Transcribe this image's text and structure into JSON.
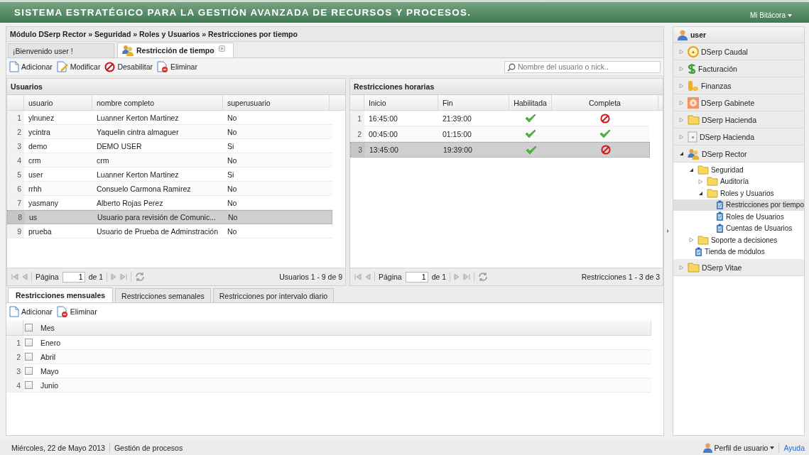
{
  "header": {
    "title": "SISTEMA ESTRATÉGICO PARA LA GESTIÓN AVANZADA DE RECURSOS Y PROCESOS.",
    "menu": "Mi Bitácora"
  },
  "breadcrumb": "Módulo DSerp Rector » Seguridad » Roles y Usuarios » Restricciones por tiempo",
  "tabs": [
    {
      "label": "¡Bienvenido user !",
      "selected": false,
      "closable": false
    },
    {
      "label": "Restricción de tiempo",
      "selected": true,
      "closable": true
    }
  ],
  "toolbar": {
    "buttons": [
      {
        "label": "Adicionar",
        "kind": "add"
      },
      {
        "label": "Modificar",
        "kind": "edit"
      },
      {
        "label": "Desabilitar",
        "kind": "disable"
      },
      {
        "label": "Eliminar",
        "kind": "delete"
      }
    ],
    "search": {
      "placeholder": "Nombre del usuario o nick.."
    }
  },
  "users": {
    "title": "Usuarios",
    "columns": [
      "usuario",
      "nombre completo",
      "superusuario"
    ],
    "rows": [
      {
        "num": "1",
        "usuario": "ylnunez",
        "nombre": "Luanner Kerton Martinez",
        "super": "No",
        "selected": false
      },
      {
        "num": "2",
        "usuario": "ycintra",
        "nombre": "Yaquelin cintra almaguer",
        "super": "No",
        "selected": false
      },
      {
        "num": "3",
        "usuario": "demo",
        "nombre": "DEMO USER",
        "super": "Si",
        "selected": false
      },
      {
        "num": "4",
        "usuario": "crm",
        "nombre": "crm",
        "super": "No",
        "selected": false
      },
      {
        "num": "5",
        "usuario": "user",
        "nombre": "Luanner Kerton Martinez",
        "super": "Si",
        "selected": false
      },
      {
        "num": "6",
        "usuario": "rrhh",
        "nombre": "Consuelo Carmona Ramirez",
        "super": "No",
        "selected": false
      },
      {
        "num": "7",
        "usuario": "yasmany",
        "nombre": "Alberto Rojas Perez",
        "super": "No",
        "selected": false
      },
      {
        "num": "8",
        "usuario": "us",
        "nombre": "Usuario para revisión de Comunic...",
        "super": "No",
        "selected": true
      },
      {
        "num": "9",
        "usuario": "prueba",
        "nombre": "Usuario de Prueba de Adminstración",
        "super": "No",
        "selected": false
      }
    ],
    "pager": {
      "label": "Página",
      "page": "1",
      "of": "de 1",
      "summary": "Usuarios 1 - 9 de 9"
    }
  },
  "restrictions": {
    "title": "Restricciones horarias",
    "columns": [
      "Inicio",
      "Fin",
      "Habilitada",
      "Completa"
    ],
    "rows": [
      {
        "num": "1",
        "inicio": "16:45:00",
        "fin": "21:39:00",
        "habilitada": true,
        "completa": false,
        "selected": false
      },
      {
        "num": "2",
        "inicio": "00:45:00",
        "fin": "01:15:00",
        "habilitada": true,
        "completa": true,
        "selected": false
      },
      {
        "num": "3",
        "inicio": "13:45:00",
        "fin": "19:39:00",
        "habilitada": true,
        "completa": false,
        "selected": true
      }
    ],
    "pager": {
      "label": "Página",
      "page": "1",
      "of": "de 1",
      "summary": "Restricciones 1 - 3 de 3"
    }
  },
  "bottom_tabs": [
    {
      "label": "Restricciones mensuales",
      "selected": true
    },
    {
      "label": "Restricciones semanales",
      "selected": false
    },
    {
      "label": "Restricciones por intervalo diario",
      "selected": false
    }
  ],
  "bottom_toolbar": [
    {
      "label": "Adicionar",
      "kind": "add"
    },
    {
      "label": "Eliminar",
      "kind": "delete"
    }
  ],
  "months": {
    "column": "Mes",
    "all_checked": false,
    "rows": [
      {
        "num": "1",
        "mes": "Enero",
        "checked": false
      },
      {
        "num": "2",
        "mes": "Abril",
        "checked": false
      },
      {
        "num": "3",
        "mes": "Mayo",
        "checked": false
      },
      {
        "num": "4",
        "mes": "Junio",
        "checked": false
      }
    ]
  },
  "sidebar": {
    "user": "user",
    "items": [
      {
        "label": "DSerp Caudal",
        "expanded": false
      },
      {
        "label": "Facturación",
        "expanded": false
      },
      {
        "label": "Finanzas",
        "expanded": false
      },
      {
        "label": "DSerp Gabinete",
        "expanded": false
      },
      {
        "label": "DSerp Hacienda",
        "expanded": false
      },
      {
        "label": "DSerp Hacienda",
        "expanded": false
      },
      {
        "label": "DSerp Rector",
        "expanded": true,
        "children": [
          {
            "label": "Seguridad",
            "kind": "folder",
            "expanded": true,
            "selected": false,
            "children": [
              {
                "label": "Auditoría",
                "kind": "folder",
                "expanded": false,
                "selected": false
              },
              {
                "label": "Roles y Usuarios",
                "kind": "folder",
                "expanded": true,
                "selected": false,
                "children": [
                  {
                    "label": "Restricciones por tiempo",
                    "kind": "leaf",
                    "selected": true
                  },
                  {
                    "label": "Roles de Usuarios",
                    "kind": "leaf",
                    "selected": false
                  },
                  {
                    "label": "Cuentas de Usuarios",
                    "kind": "leaf",
                    "selected": false
                  }
                ]
              }
            ]
          },
          {
            "label": "Soporte a decisiones",
            "kind": "folder",
            "expanded": false,
            "selected": false
          },
          {
            "label": "Tienda de módulos",
            "kind": "leaf",
            "selected": false
          }
        ]
      },
      {
        "label": "DSerp Vitae",
        "expanded": false
      }
    ]
  },
  "status_bar": {
    "date": "Miércoles, 22 de Mayo 2013",
    "section": "Gestión de procesos",
    "profile": "Perfil de usuario",
    "help": "Ayuda"
  }
}
